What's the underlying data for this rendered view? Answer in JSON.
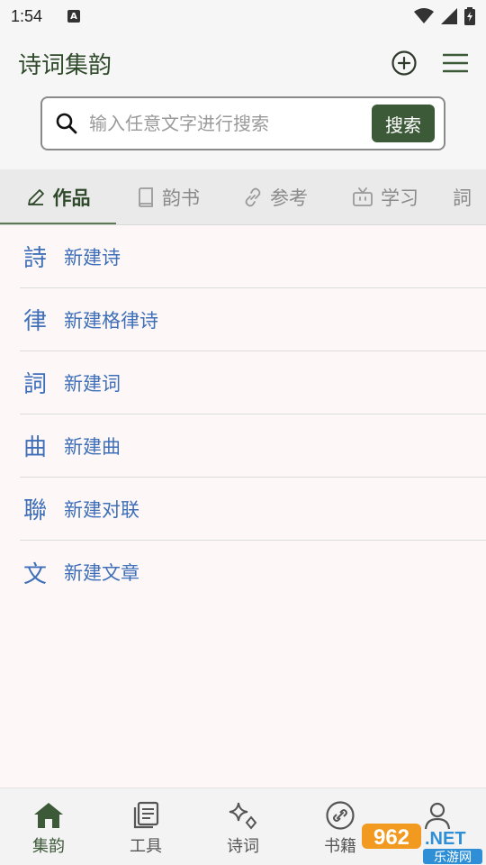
{
  "status_bar": {
    "time": "1:54",
    "notification_letter": "A"
  },
  "app": {
    "title": "诗词集韵"
  },
  "search": {
    "placeholder": "输入任意文字进行搜索",
    "button_label": "搜索"
  },
  "tabs": [
    {
      "label": "作品",
      "icon": "pencil-icon",
      "active": true
    },
    {
      "label": "韵书",
      "icon": "book-icon",
      "active": false
    },
    {
      "label": "参考",
      "icon": "link-icon",
      "active": false
    },
    {
      "label": "学习",
      "icon": "tv-icon",
      "active": false
    },
    {
      "label": "詞",
      "icon": "",
      "active": false
    }
  ],
  "list": [
    {
      "glyph": "詩",
      "label": "新建诗"
    },
    {
      "glyph": "律",
      "label": "新建格律诗"
    },
    {
      "glyph": "詞",
      "label": "新建词"
    },
    {
      "glyph": "曲",
      "label": "新建曲"
    },
    {
      "glyph": "聯",
      "label": "新建对联"
    },
    {
      "glyph": "文",
      "label": "新建文章"
    }
  ],
  "bottom_nav": [
    {
      "label": "集韵",
      "icon": "home-icon",
      "active": true
    },
    {
      "label": "工具",
      "icon": "document-icon",
      "active": false
    },
    {
      "label": "诗词",
      "icon": "sparkle-icon",
      "active": false
    },
    {
      "label": "书籍",
      "icon": "link-circle-icon",
      "active": false
    },
    {
      "label": "",
      "icon": "person-icon",
      "active": false
    }
  ],
  "watermark": {
    "main": "962",
    "suffix": ".NET",
    "sub": "乐游网"
  },
  "colors": {
    "accent": "#3c5a38",
    "link": "#3f6fb8",
    "title": "#2f4a2a"
  }
}
